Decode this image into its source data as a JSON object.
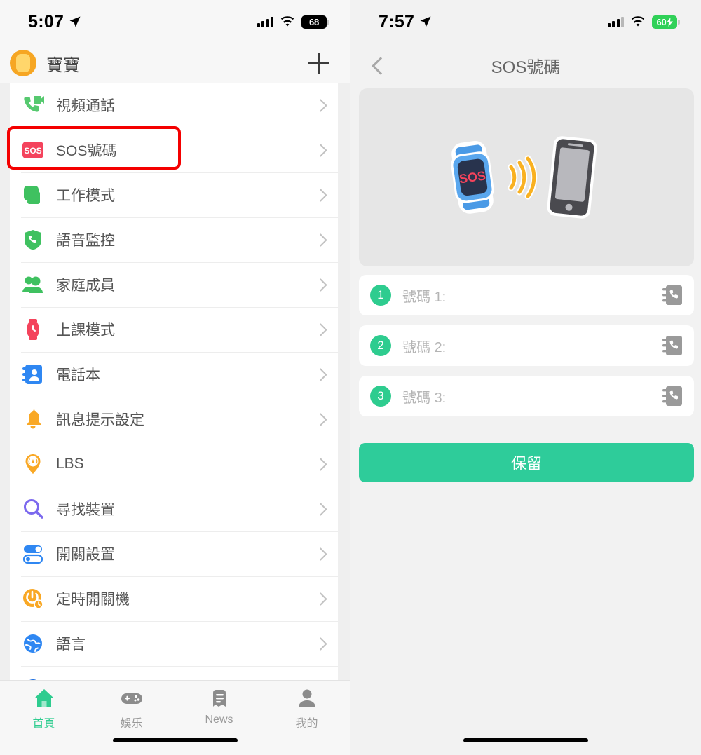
{
  "left": {
    "status": {
      "time": "5:07",
      "battery_text": "68",
      "battery_style": "dark"
    },
    "header": {
      "title": "寶寶",
      "add_label": "+"
    },
    "menu": [
      {
        "label": "視頻通話",
        "icon": "video-call-icon"
      },
      {
        "label": "SOS號碼",
        "icon": "sos-icon",
        "highlighted": true
      },
      {
        "label": "工作模式",
        "icon": "work-mode-icon"
      },
      {
        "label": "語音監控",
        "icon": "voice-monitor-icon"
      },
      {
        "label": "家庭成員",
        "icon": "family-members-icon"
      },
      {
        "label": "上課模式",
        "icon": "class-mode-icon"
      },
      {
        "label": "電話本",
        "icon": "phonebook-icon"
      },
      {
        "label": "訊息提示設定",
        "icon": "notification-bell-icon"
      },
      {
        "label": "LBS",
        "icon": "lbs-pin-icon"
      },
      {
        "label": "尋找裝置",
        "icon": "find-device-icon"
      },
      {
        "label": "開關設置",
        "icon": "switch-settings-icon"
      },
      {
        "label": "定時開關機",
        "icon": "scheduled-power-icon"
      },
      {
        "label": "語言",
        "icon": "language-globe-icon"
      }
    ],
    "tabs": [
      {
        "label": "首頁",
        "icon": "home-icon",
        "active": true
      },
      {
        "label": "娛乐",
        "icon": "gamepad-icon",
        "active": false
      },
      {
        "label": "News",
        "icon": "news-icon",
        "active": false
      },
      {
        "label": "我的",
        "icon": "person-icon",
        "active": false
      }
    ]
  },
  "right": {
    "status": {
      "time": "7:57",
      "battery_text": "60",
      "battery_style": "green"
    },
    "navbar": {
      "title": "SOS號碼",
      "back": "back-chevron"
    },
    "illustration": {
      "watch_text": "SOS"
    },
    "numbers": [
      {
        "badge": "1",
        "placeholder": "號碼 1:",
        "value": ""
      },
      {
        "badge": "2",
        "placeholder": "號碼 2:",
        "value": ""
      },
      {
        "badge": "3",
        "placeholder": "號碼 3:",
        "value": ""
      }
    ],
    "save_label": "保留"
  },
  "colors": {
    "accent_green": "#2ecc9a",
    "highlight_red": "#f40000",
    "sos_red": "#f4435c",
    "avatar_orange": "#f6a623"
  }
}
